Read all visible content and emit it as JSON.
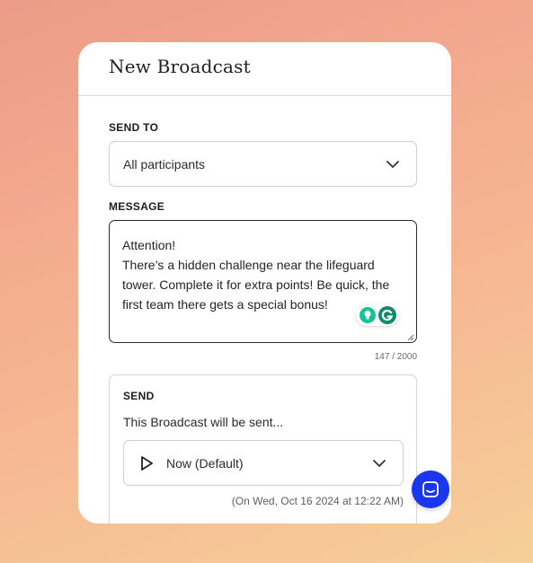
{
  "modal": {
    "title": "New Broadcast"
  },
  "send_to": {
    "label": "SEND TO",
    "selected": "All participants"
  },
  "message": {
    "label": "MESSAGE",
    "value": "Attention!\nThere’s a hidden challenge near the lifeguard tower. Complete it for extra points! Be quick, the first team there gets a special bonus!",
    "counter": "147 / 2000"
  },
  "send": {
    "label": "SEND",
    "description": "This Broadcast will be sent...",
    "timing_selected": "Now (Default)",
    "timing_note": "(On Wed, Oct 16 2024 at 12:22 AM)"
  },
  "icons": {
    "send_to_chevron": "chevron-down-icon",
    "timing_chevron": "chevron-down-icon",
    "play": "play-icon",
    "grammarly_bulb": "lightbulb-icon",
    "grammarly_logo": "grammarly-icon",
    "chat": "chat-icon"
  },
  "colors": {
    "chat_button": "#1a36ef",
    "grammarly_green": "#15c39a"
  }
}
